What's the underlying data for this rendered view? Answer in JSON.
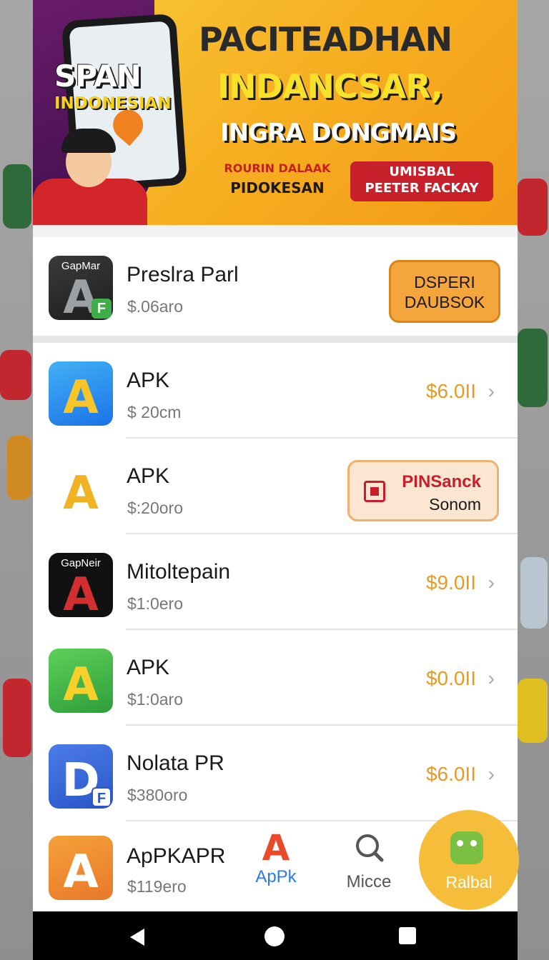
{
  "banner": {
    "left_title": "SPAN",
    "left_subtitle": "INDONESIAN",
    "headline_1": "PACITEADHAN",
    "headline_2": "INDANCSAR,",
    "headline_3": "INGRA DONGMAIS",
    "promo_left_line1": "ROURIN DALAAK",
    "promo_left_line2": "PIDOKESAN",
    "promo_right_line1": "UMISBAL",
    "promo_right_line2": "PEETER FACKAY"
  },
  "apps": [
    {
      "icon_caption": "GapMar",
      "icon_letter": "A",
      "icon_badge": "F",
      "name": "Preslra Parl",
      "sub": "$.06aro",
      "action": "DSPERI DAUBSOK"
    },
    {
      "icon_letter": "A",
      "name": "APK",
      "sub": "$ 20cm",
      "price": "$6.0II"
    },
    {
      "icon_letter": "A",
      "name": "APK",
      "sub": "$:20oro",
      "button_title": "PINSanck",
      "button_sub": "Sonom"
    },
    {
      "icon_caption": "GapNeir",
      "icon_letter": "A",
      "name": "Mitoltepain",
      "sub": "$1:0ero",
      "price": "$9.0II"
    },
    {
      "icon_letter": "A",
      "name": "APK",
      "sub": "$1:0aro",
      "price": "$0.0II"
    },
    {
      "icon_letter": "D",
      "icon_badge": "F",
      "name": "Nolata PR",
      "sub": "$380oro",
      "price": "$6.0II"
    },
    {
      "icon_letter": "A",
      "name": "ApPKAPR",
      "sub": "$119ero"
    }
  ],
  "chevron": "›",
  "nav": {
    "apk_icon": "A",
    "apk_label": "ApPk",
    "search_label": "Micce",
    "fab_label": "Ralbal"
  },
  "colors": {
    "price": "#e89a23",
    "banner": "#f6ad1f",
    "accent_red": "#c8202a"
  }
}
